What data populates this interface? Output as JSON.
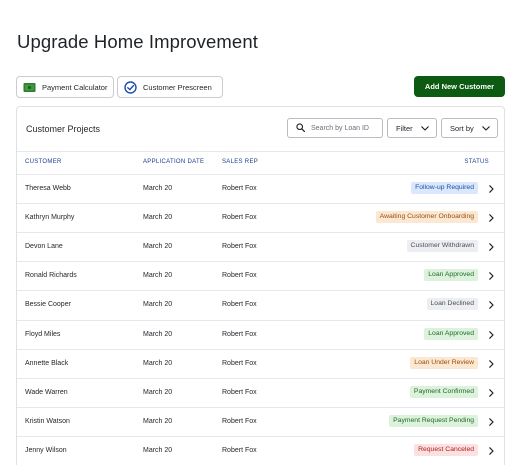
{
  "page": {
    "title": "Upgrade Home Improvement"
  },
  "toolbar": {
    "payment_calculator": "Payment Calculator",
    "customer_prescreen": "Customer Prescreen",
    "add_customer": "Add New Customer"
  },
  "projects": {
    "title": "Customer Projects",
    "search_placeholder": "Search by Loan ID",
    "filter_label": "Filter",
    "sort_label": "Sort by",
    "columns": {
      "customer": "CUSTOMER",
      "application_date": "APPLICATION DATE",
      "sales_rep": "SALES REP",
      "status": "STATUS"
    },
    "rows": [
      {
        "customer": "Theresa Webb",
        "date": "March 20",
        "rep": "Robert Fox",
        "status": "Follow-up Required",
        "tone": "blue"
      },
      {
        "customer": "Kathryn Murphy",
        "date": "March 20",
        "rep": "Robert Fox",
        "status": "Awaiting Customer Onboarding",
        "tone": "orange"
      },
      {
        "customer": "Devon Lane",
        "date": "March 20",
        "rep": "Robert Fox",
        "status": "Customer Withdrawn",
        "tone": "gray"
      },
      {
        "customer": "Ronald Richards",
        "date": "March 20",
        "rep": "Robert Fox",
        "status": "Loan Approved",
        "tone": "green"
      },
      {
        "customer": "Bessie Cooper",
        "date": "March 20",
        "rep": "Robert Fox",
        "status": "Loan Declined",
        "tone": "gray"
      },
      {
        "customer": "Floyd Miles",
        "date": "March 20",
        "rep": "Robert Fox",
        "status": "Loan Approved",
        "tone": "green"
      },
      {
        "customer": "Annette Black",
        "date": "March 20",
        "rep": "Robert Fox",
        "status": "Loan Under Review",
        "tone": "orange"
      },
      {
        "customer": "Wade Warren",
        "date": "March 20",
        "rep": "Robert Fox",
        "status": "Payment Confirmed",
        "tone": "green"
      },
      {
        "customer": "Kristin Watson",
        "date": "March 20",
        "rep": "Robert Fox",
        "status": "Payment Request Pending",
        "tone": "green"
      },
      {
        "customer": "Jenny Wilson",
        "date": "March 20",
        "rep": "Robert Fox",
        "status": "Request Canceled",
        "tone": "red"
      }
    ]
  },
  "colors": {
    "primary": "#0d5a12",
    "header_text": "#1c3d8f",
    "badge_blue": "#dbe8fb",
    "badge_orange": "#fbe8d3",
    "badge_gray": "#eceef1",
    "badge_green": "#dcf2dc",
    "badge_red": "#fbe1e1"
  },
  "icons": {
    "payment_calculator": "money-icon",
    "customer_prescreen": "check-circle-icon",
    "search": "search-icon",
    "dropdown": "chevron-down-icon",
    "row_action": "chevron-right-icon"
  }
}
